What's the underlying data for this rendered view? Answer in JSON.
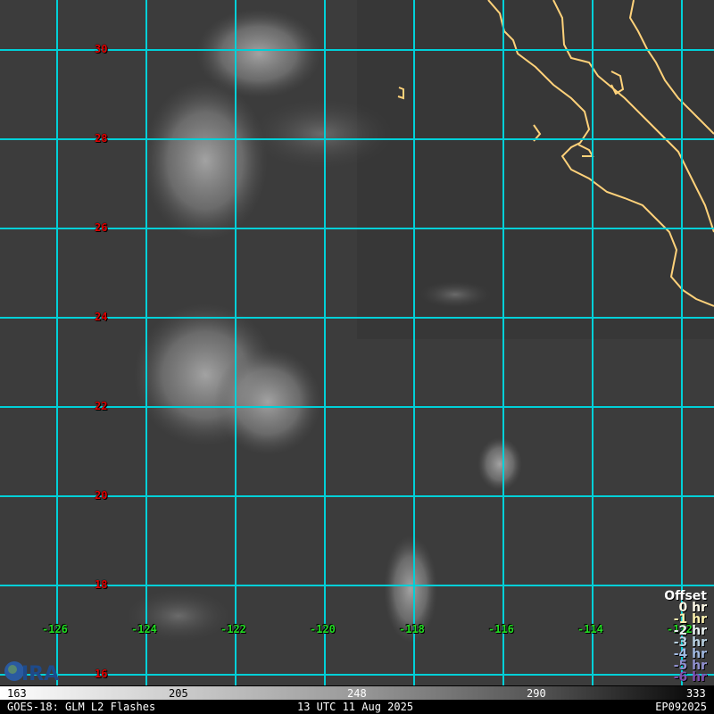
{
  "map": {
    "lat_labels": [
      "30",
      "28",
      "26",
      "24",
      "22",
      "20",
      "18",
      "16"
    ],
    "lon_labels": [
      "-126",
      "-124",
      "-122",
      "-120",
      "-118",
      "-116",
      "-114",
      "-112"
    ],
    "grid_color": "#00d0d8",
    "coast_color": "#ffd27a"
  },
  "legend": {
    "title": "Offset",
    "items": [
      {
        "label": "0 hr",
        "color": "#fffbe8"
      },
      {
        "label": "-1 hr",
        "color": "#fff4b0"
      },
      {
        "label": "-2 hr",
        "color": "#e8f0f0"
      },
      {
        "label": "-3 hr",
        "color": "#b8d0e0"
      },
      {
        "label": "-4 hr",
        "color": "#a0b8e0"
      },
      {
        "label": "-5 hr",
        "color": "#9090d0"
      },
      {
        "label": "-6 hr",
        "color": "#8050b0"
      }
    ]
  },
  "colorbar": {
    "ticks": [
      "163",
      "205",
      "248",
      "290",
      "333"
    ]
  },
  "footer": {
    "product": "GOES-18: GLM L2 Flashes",
    "time": "13 UTC 11 Aug 2025",
    "storm": "EP092025"
  },
  "logo": {
    "text": "CIRA"
  }
}
